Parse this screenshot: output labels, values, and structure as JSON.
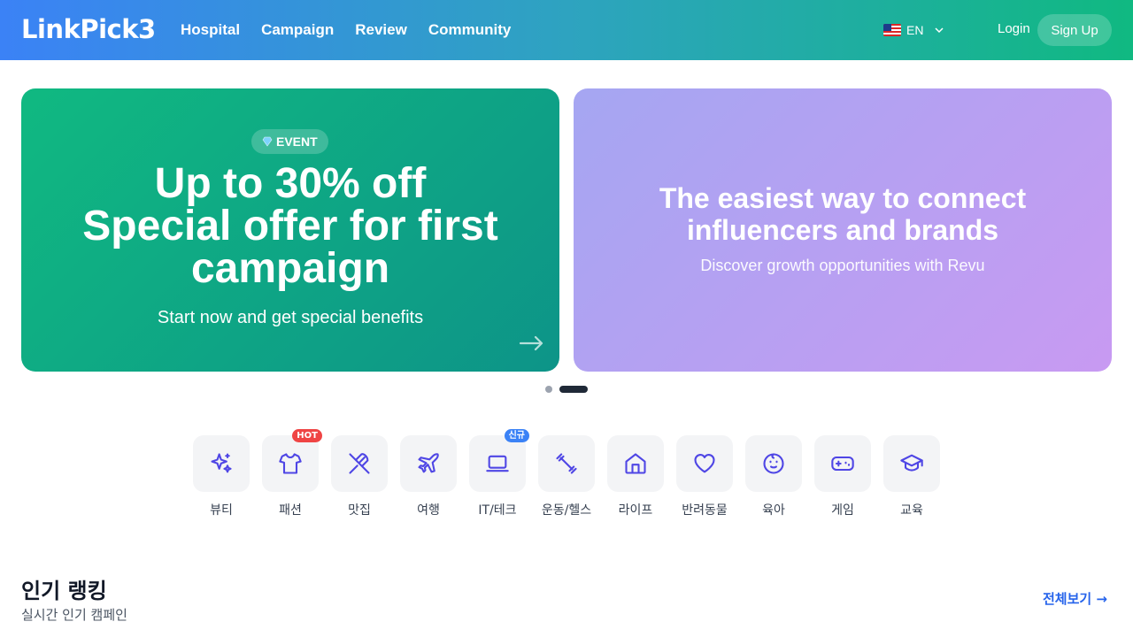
{
  "header": {
    "logo": "LinkPick3",
    "nav": [
      "Hospital",
      "Campaign",
      "Review",
      "Community"
    ],
    "language": "EN",
    "login": "Login",
    "signup": "Sign Up"
  },
  "banners": [
    {
      "badge": "EVENT",
      "title_lines": [
        "Up to 30% off",
        "Special offer for first",
        "campaign"
      ],
      "subtitle": "Start now and get special benefits"
    },
    {
      "title_lines": [
        "The easiest way to connect",
        "influencers and brands"
      ],
      "subtitle": "Discover growth opportunities with Revu"
    }
  ],
  "carousel": {
    "count": 2,
    "active": 2
  },
  "categories": [
    {
      "label": "뷰티",
      "icon": "sparkles-icon"
    },
    {
      "label": "패션",
      "icon": "shirt-icon",
      "tag": "HOT"
    },
    {
      "label": "맛집",
      "icon": "utensils-icon"
    },
    {
      "label": "여행",
      "icon": "plane-icon"
    },
    {
      "label": "IT/테크",
      "icon": "laptop-icon",
      "tag": "신규"
    },
    {
      "label": "운동/헬스",
      "icon": "dumbbell-icon"
    },
    {
      "label": "라이프",
      "icon": "home-icon"
    },
    {
      "label": "반려동물",
      "icon": "heart-icon"
    },
    {
      "label": "육아",
      "icon": "baby-icon"
    },
    {
      "label": "게임",
      "icon": "gamepad-icon"
    },
    {
      "label": "교육",
      "icon": "graduation-cap-icon"
    }
  ],
  "ranking": {
    "title": "인기 랭킹",
    "subtitle": "실시간 인기 캠페인",
    "view_all": "전체보기 →"
  },
  "colors": {
    "accent": "#4f46e5",
    "hot": "#ef4444",
    "new": "#3b82f6",
    "link": "#2563eb"
  }
}
